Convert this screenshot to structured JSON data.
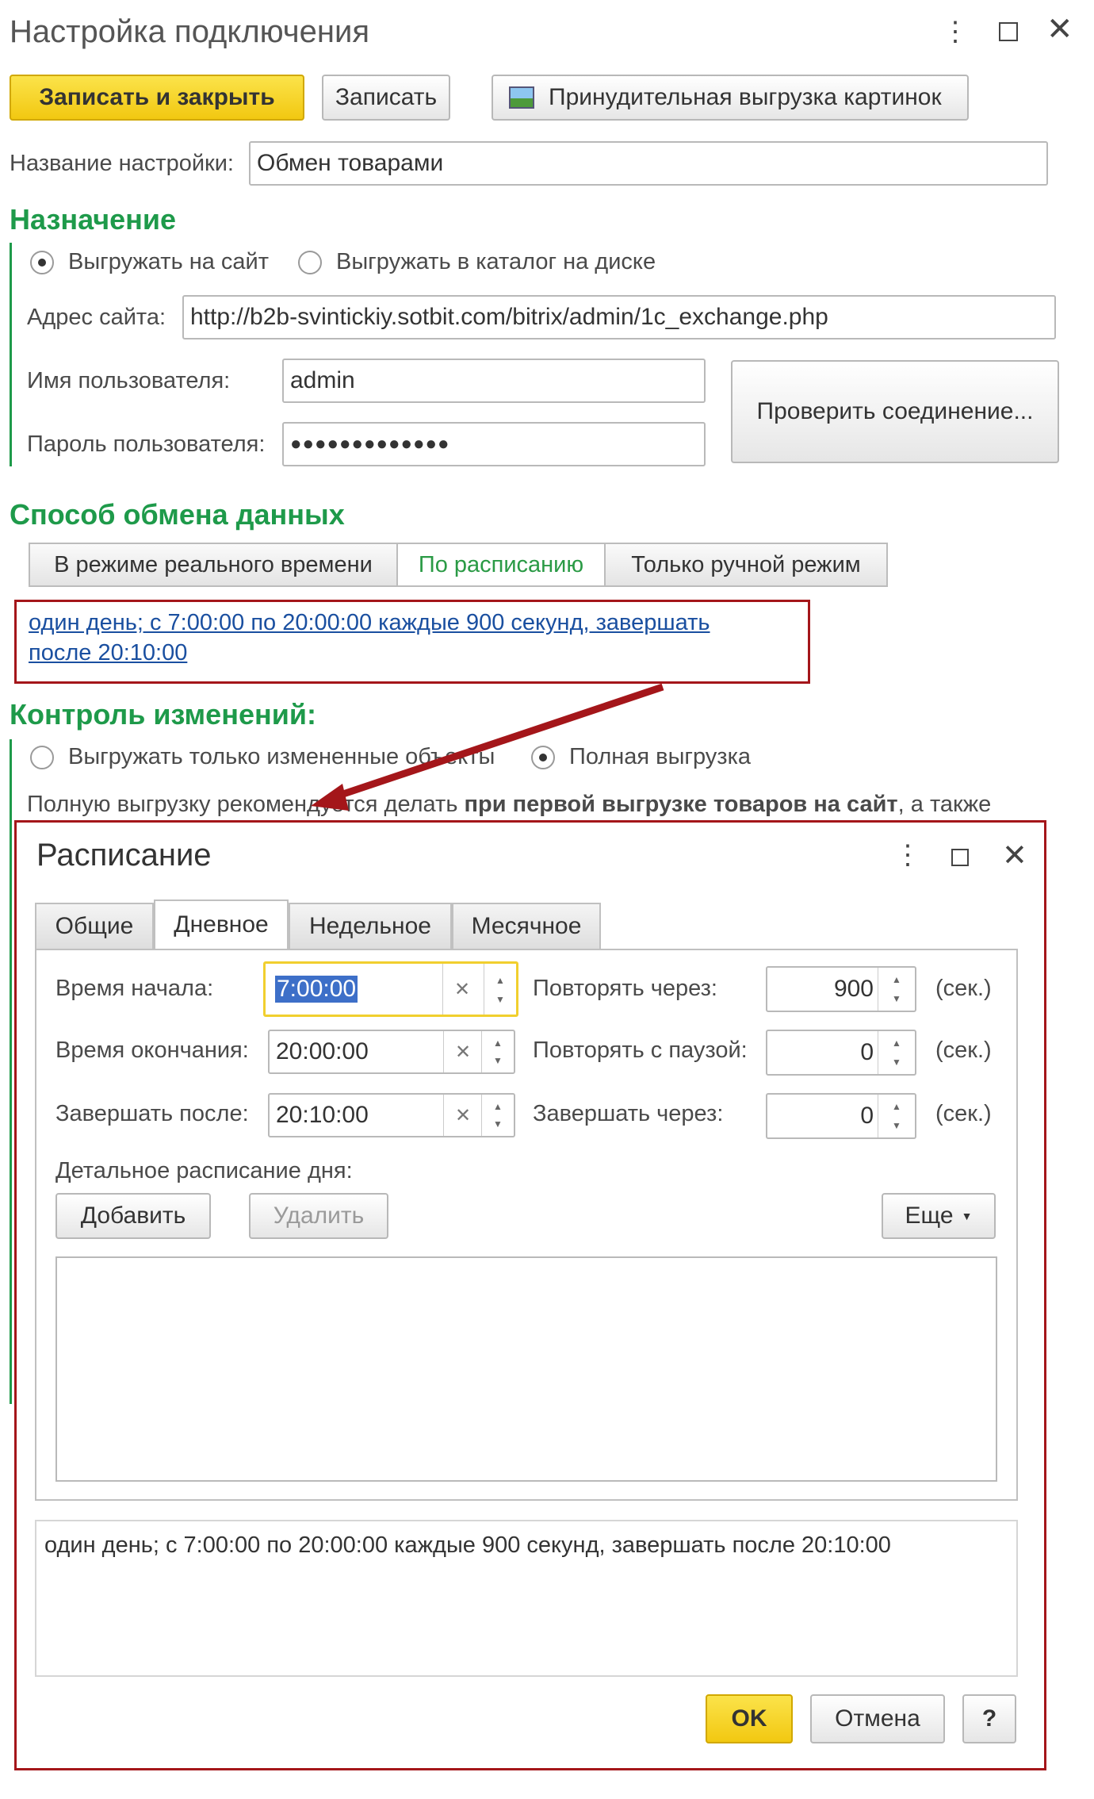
{
  "main_window": {
    "title": "Настройка подключения",
    "toolbar": {
      "save_close": "Записать и закрыть",
      "save": "Записать",
      "force_upload": "Принудительная выгрузка картинок"
    },
    "setting_name_label": "Название настройки:",
    "setting_name_value": "Обмен товарами",
    "purpose": {
      "heading": "Назначение",
      "option_site": "Выгружать на сайт",
      "option_disk": "Выгружать в каталог на диске",
      "site_address_label": "Адрес сайта:",
      "site_address_value": "http://b2b-svintickiy.sotbit.com/bitrix/admin/1c_exchange.php",
      "username_label": "Имя пользователя:",
      "username_value": "admin",
      "password_label": "Пароль пользователя:",
      "password_value": "●●●●●●●●●●●●●",
      "check_connection": "Проверить соединение..."
    },
    "exchange": {
      "heading": "Способ обмена  данных",
      "tabs": [
        "В режиме реального времени",
        "По расписанию",
        "Только ручной режим"
      ],
      "schedule_link_line1": "один день; с 7:00:00 по 20:00:00 каждые 900 секунд, завершать",
      "schedule_link_line2": "после 20:10:00"
    },
    "changes": {
      "heading": "Контроль изменений:",
      "option_changed": "Выгружать только измененные объекты",
      "option_full": "Полная выгрузка",
      "hint_start": "Полную выгрузку рекомендуется делать ",
      "hint_bold": "при первой выгрузке товаров на сайт",
      "hint_end": ", а также"
    }
  },
  "dialog": {
    "title": "Расписание",
    "tabs": [
      "Общие",
      "Дневное",
      "Недельное",
      "Месячное"
    ],
    "start_label": "Время начала:",
    "start_value": "7:00:00",
    "end_label": "Время окончания:",
    "end_value": "20:00:00",
    "finish_label": "Завершать после:",
    "finish_value": "20:10:00",
    "repeat_label": "Повторять через:",
    "repeat_value": "900",
    "pause_label": "Повторять с паузой:",
    "pause_value": "0",
    "finish_in_label": "Завершать через:",
    "finish_in_value": "0",
    "unit": "(сек.)",
    "detail_label": "Детальное расписание дня:",
    "add": "Добавить",
    "delete": "Удалить",
    "more": "Еще",
    "summary": "один день; с 7:00:00 по 20:00:00 каждые 900 секунд, завершать после 20:10:00",
    "ok": "OK",
    "cancel": "Отмена",
    "help": "?"
  },
  "colors": {
    "accent_green": "#1e9a4a",
    "highlight_red": "#a4161a",
    "yellow_button": "#f2c811"
  }
}
